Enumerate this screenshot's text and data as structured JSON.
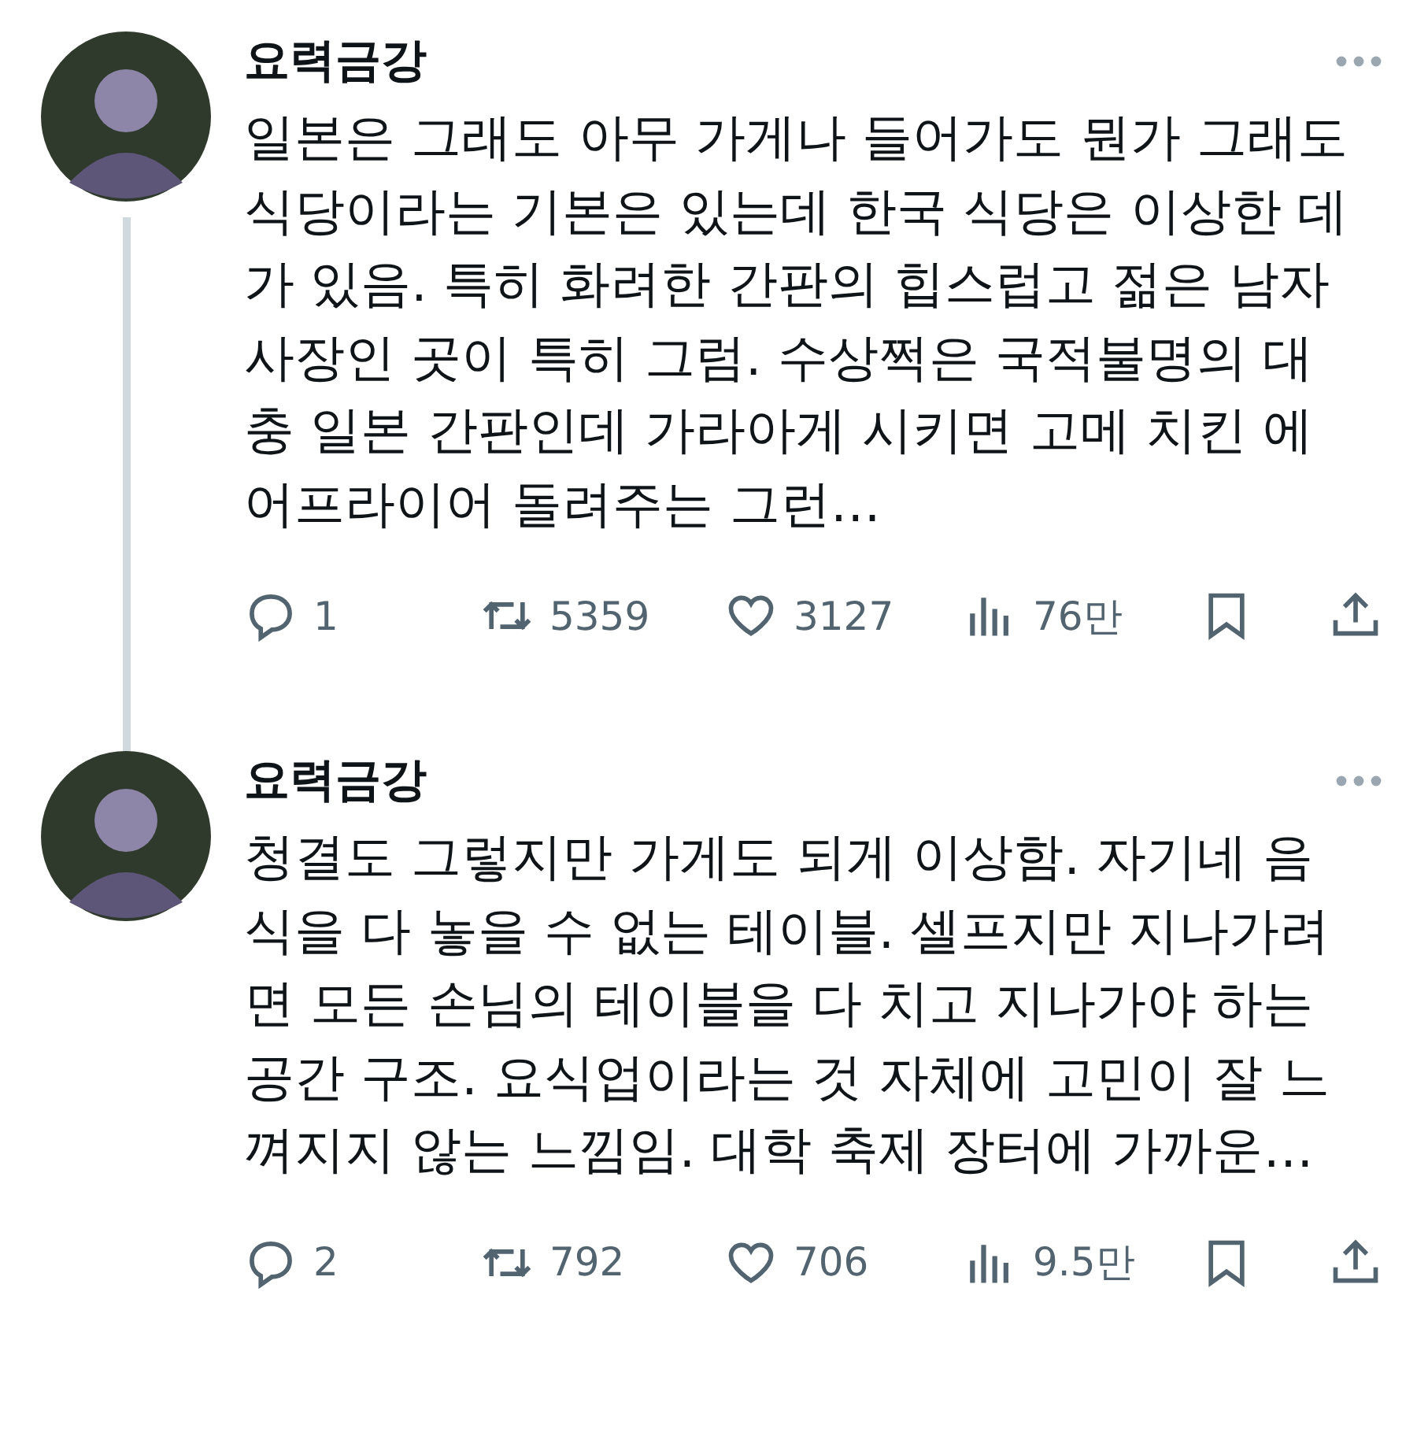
{
  "tweets": [
    {
      "name": "요력금강",
      "text": "일본은 그래도 아무 가게나 들어가도 뭔가 그래도 식당이라는 기본은 있는데 한국 식당은 이상한 데가 있음. 특히 화려한 간판의 힙스럽고 젊은 남자 사장인 곳이 특히 그럼. 수상쩍은 국적불명의 대충 일본 간판인데 가라아게 시키면 고메 치킨 에어프라이어 돌려주는 그런…",
      "thread_line": true,
      "replies": "1",
      "reposts": "5359",
      "likes": "3127",
      "views": "76만"
    },
    {
      "name": "요력금강",
      "text": "청결도 그렇지만 가게도 되게 이상함. 자기네 음식을 다 놓을 수 없는 테이블. 셀프지만 지나가려면 모든 손님의 테이블을 다 치고 지나가야 하는 공간 구조. 요식업이라는 것 자체에 고민이 잘 느껴지지 않는 느낌임. 대학 축제 장터에 가까운…",
      "thread_line": false,
      "replies": "2",
      "reposts": "792",
      "likes": "706",
      "views": "9.5만"
    }
  ]
}
